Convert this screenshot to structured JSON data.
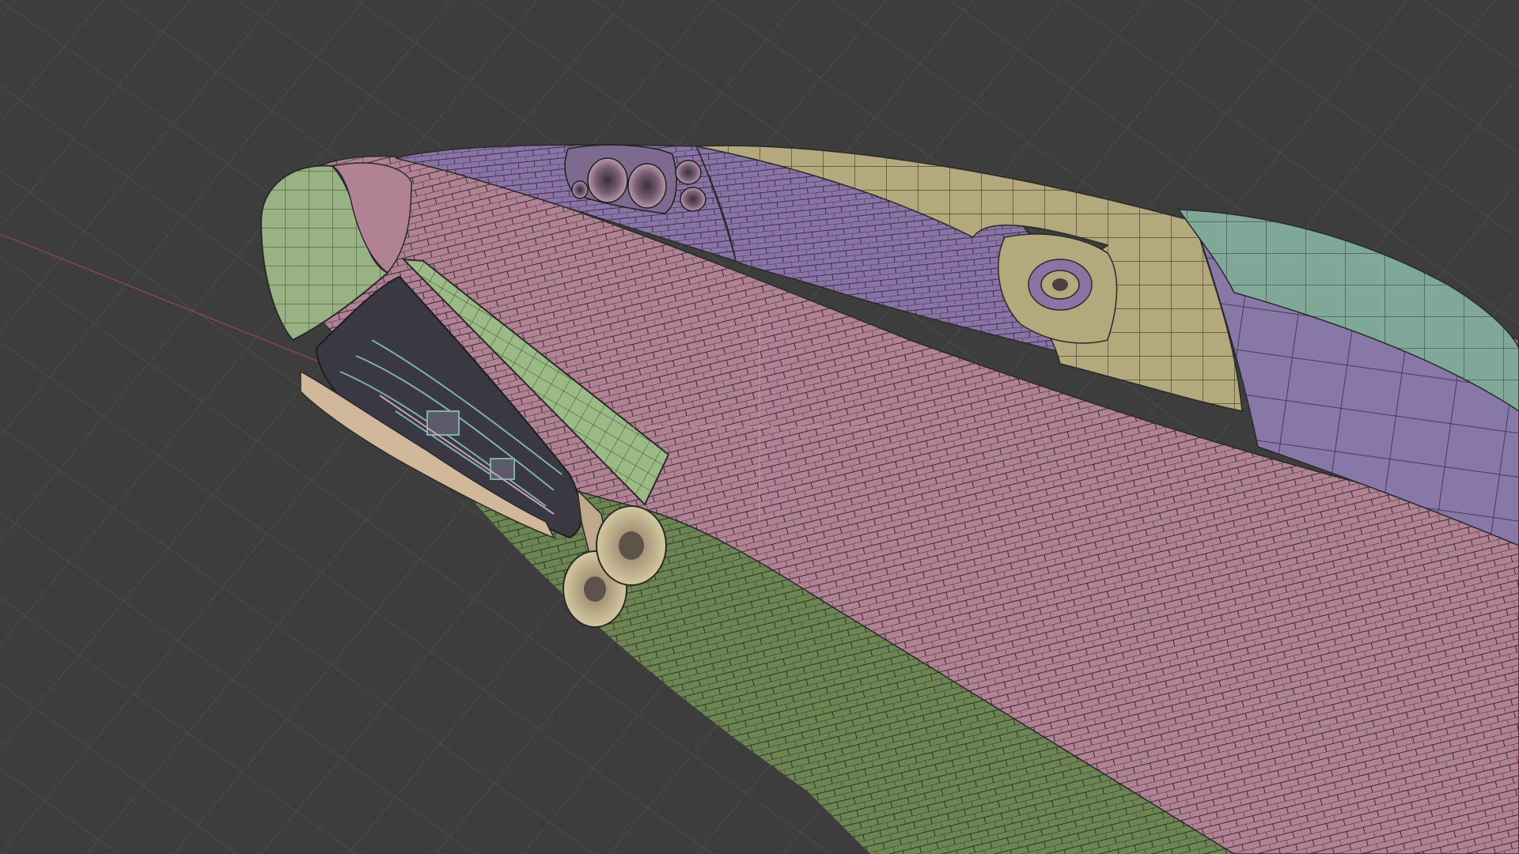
{
  "app": {
    "view": "3D Viewport"
  },
  "scene": {
    "subject": "shuttle-orbiter-nose",
    "colors": {
      "background": "#3d3d3d",
      "grid_line": "#4a4a4a",
      "x_axis": "#a04848",
      "nose_cap": "#98b283",
      "pink_tiles": "#b08294",
      "purple_tiles": "#8a74a6",
      "yellow_tiles": "#b4a97c",
      "green_tiles": "#6d8453",
      "teal_panel": "#7fa898",
      "door": "#9cba86",
      "wheel": "#c9be96",
      "tile_line": "#2a2a2a"
    }
  }
}
